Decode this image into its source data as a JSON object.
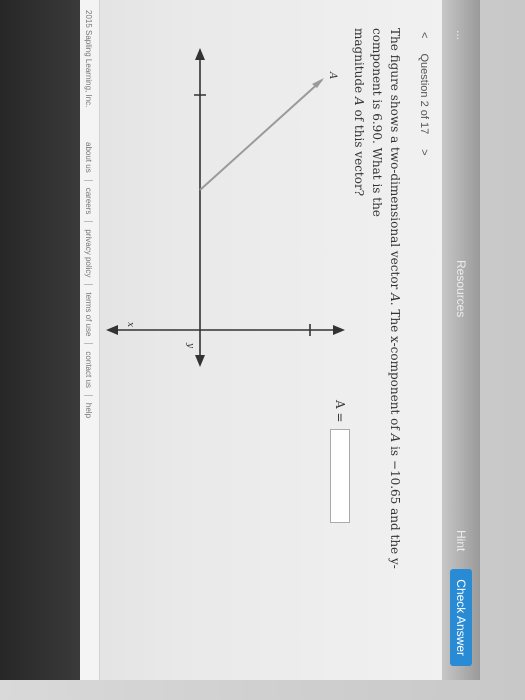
{
  "toolbar": {
    "left_tab": "...",
    "resources_label": "Resources",
    "hint_label": "Hint",
    "check_answer_label": "Check Answer"
  },
  "question": {
    "prev_label": "<",
    "counter": "Question 2 of 17",
    "next_label": ">",
    "text_1": "The figure shows a two-dimensional vector",
    "vector_symbol": "A",
    "text_2": ". The x-component of",
    "text_3": "is −10.65 and the y-component is 6.90. What is the",
    "text_4": "magnitude",
    "magnitude_symbol": "A",
    "text_5": "of this vector?",
    "answer_label": "A =",
    "answer_value": ""
  },
  "figure": {
    "vector_label": "A",
    "x_axis_label": "x",
    "y_axis_label": "y",
    "x_component": -10.65,
    "y_component": 6.9
  },
  "footer": {
    "copyright": "2015 Sapling Learning, Inc.",
    "links": [
      "about us",
      "careers",
      "privacy policy",
      "terms of use",
      "contact us",
      "help"
    ]
  },
  "colors": {
    "accent": "#2a8bd5",
    "vector": "#9a9a9a"
  }
}
